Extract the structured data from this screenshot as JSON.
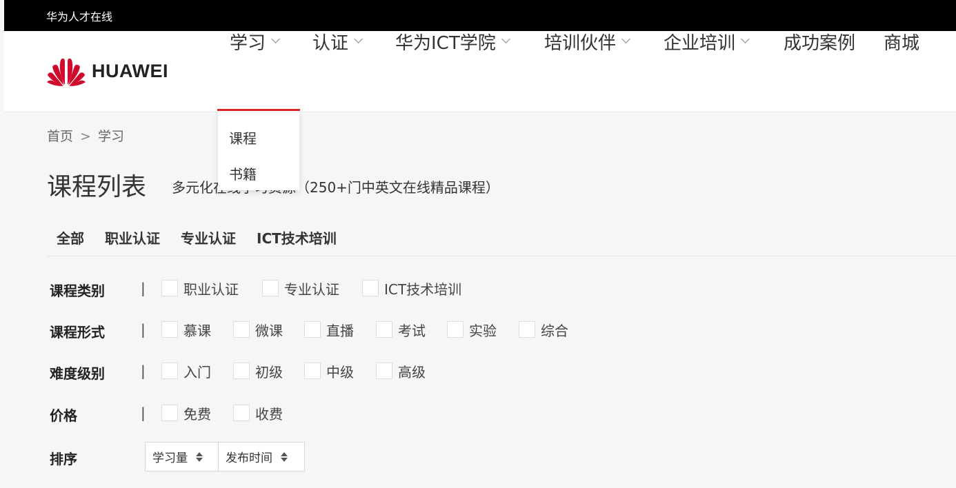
{
  "topbar": {
    "site_name": "华为人才在线"
  },
  "logo": {
    "wordmark": "HUAWEI",
    "icon": "huawei-petal-icon",
    "brand_color": "#cf0a2c"
  },
  "nav": {
    "items": [
      {
        "label": "学习",
        "has_dropdown": true
      },
      {
        "label": "认证",
        "has_dropdown": true
      },
      {
        "label": "华为ICT学院",
        "has_dropdown": true
      },
      {
        "label": "培训伙伴",
        "has_dropdown": true
      },
      {
        "label": "企业培训",
        "has_dropdown": true
      },
      {
        "label": "成功案例",
        "has_dropdown": false
      },
      {
        "label": "商城",
        "has_dropdown": false
      }
    ],
    "active_index": 0,
    "active_color": "#e0262a"
  },
  "dropdown": {
    "items": [
      "课程",
      "书籍"
    ]
  },
  "breadcrumb": {
    "home": "首页",
    "separator": ">",
    "current": "学习"
  },
  "page": {
    "title": "课程列表",
    "subtitle": "多元化在线学习资源（250+门中英文在线精品课程）"
  },
  "tabs": [
    "全部",
    "职业认证",
    "专业认证",
    "ICT技术培训"
  ],
  "filters": [
    {
      "label": "课程类别",
      "separator": "|",
      "options": [
        "职业认证",
        "专业认证",
        "ICT技术培训"
      ]
    },
    {
      "label": "课程形式",
      "separator": "|",
      "options": [
        "慕课",
        "微课",
        "直播",
        "考试",
        "实验",
        "综合"
      ]
    },
    {
      "label": "难度级别",
      "separator": "|",
      "options": [
        "入门",
        "初级",
        "中级",
        "高级"
      ]
    },
    {
      "label": "价格",
      "separator": "|",
      "options": [
        "免费",
        "收费"
      ]
    }
  ],
  "sort": {
    "label": "排序",
    "options": [
      "学习量",
      "发布时间"
    ],
    "icon": "sort-updown-icon"
  }
}
